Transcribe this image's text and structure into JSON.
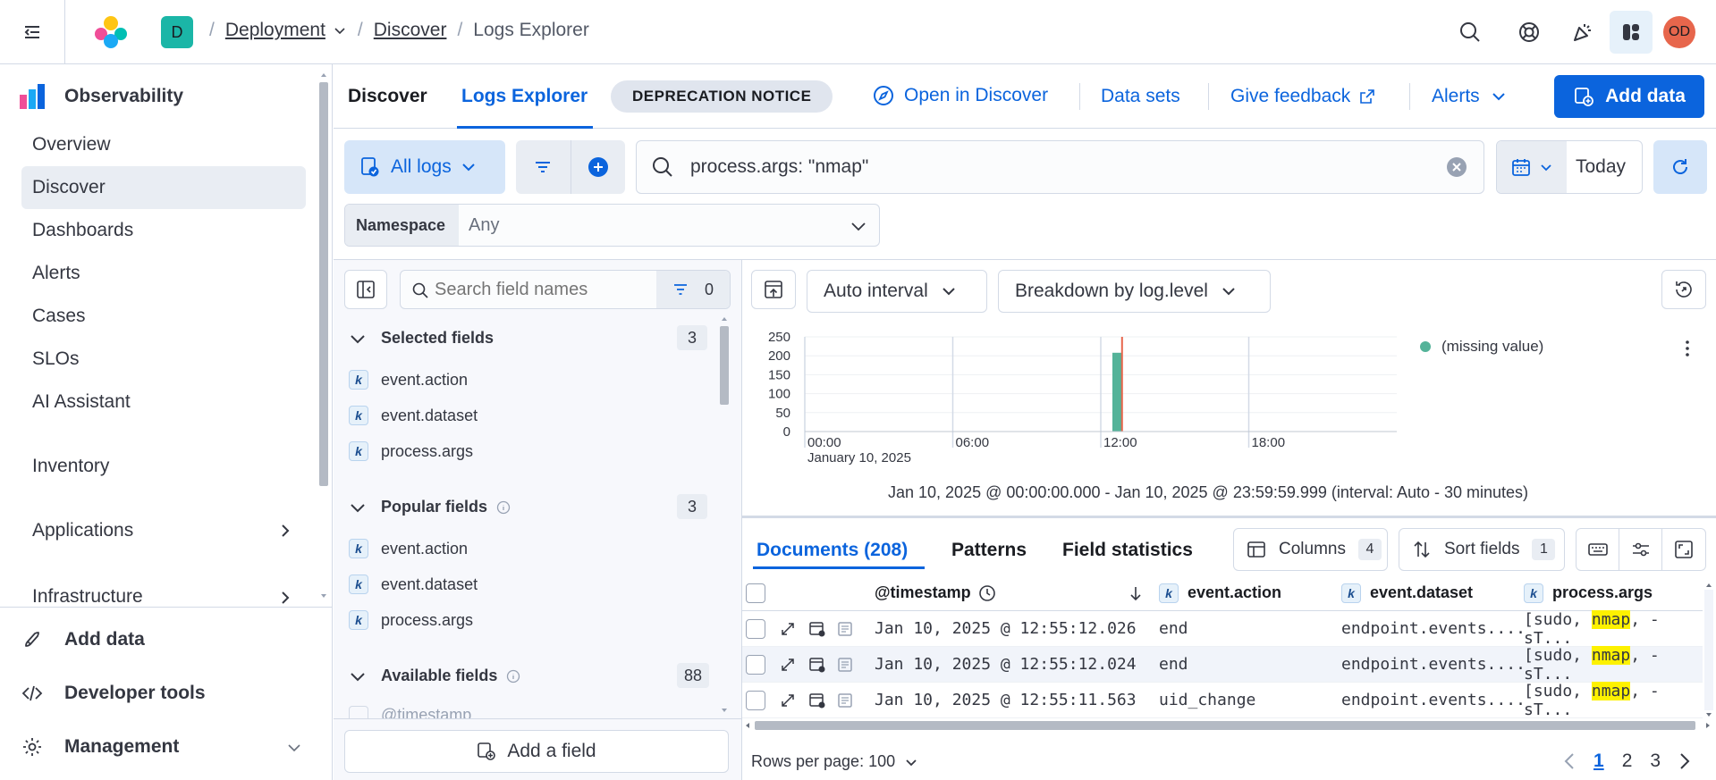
{
  "header": {
    "space_initial": "D",
    "breadcrumbs": [
      "Deployment",
      "Discover",
      "Logs Explorer"
    ],
    "avatar": "OD",
    "colors": {
      "space": "#1bb6a7",
      "avatar": "#e7664c"
    }
  },
  "sidebar": {
    "title": "Observability",
    "items": [
      "Overview",
      "Discover",
      "Dashboards",
      "Alerts",
      "Cases",
      "SLOs",
      "AI Assistant",
      "Inventory",
      "Applications",
      "Infrastructure"
    ],
    "footer": [
      "Add data",
      "Developer tools",
      "Management"
    ]
  },
  "tabs": {
    "discover": "Discover",
    "logs_explorer": "Logs Explorer",
    "notice": "DEPRECATION NOTICE",
    "open_in_discover": "Open in Discover",
    "data_sets": "Data sets",
    "give_feedback": "Give feedback",
    "alerts": "Alerts",
    "add_data": "Add data"
  },
  "query": {
    "data_view": "All logs",
    "text": "process.args: \"nmap\"",
    "date": "Today",
    "namespace_label": "Namespace",
    "namespace_value": "Any"
  },
  "fields_panel": {
    "search_placeholder": "Search field names",
    "filter_count": "0",
    "selected": {
      "title": "Selected fields",
      "count": "3",
      "items": [
        "event.action",
        "event.dataset",
        "process.args"
      ]
    },
    "popular": {
      "title": "Popular fields",
      "count": "3",
      "items": [
        "event.action",
        "event.dataset",
        "process.args"
      ]
    },
    "available": {
      "title": "Available fields",
      "count": "88",
      "first": "@timestamp"
    },
    "add_field": "Add a field"
  },
  "histogram": {
    "interval": "Auto interval",
    "breakdown": "Breakdown by log.level",
    "legend": "(missing value)",
    "date_label": "January 10, 2025",
    "range_text": "Jan 10, 2025 @ 00:00:00.000 - Jan 10, 2025 @ 23:59:59.999 (interval: Auto - 30 minutes)"
  },
  "chart_data": {
    "type": "bar",
    "x_ticks": [
      "00:00",
      "06:00",
      "12:00",
      "18:00"
    ],
    "y_ticks": [
      0,
      50,
      100,
      150,
      200,
      250
    ],
    "ylim": [
      0,
      250
    ],
    "x_range_hours": [
      0,
      24
    ],
    "bars": [
      {
        "x_hours": 12.0,
        "y": 208
      }
    ],
    "now_marker_hours": 12.5,
    "series": [
      {
        "name": "(missing value)",
        "color": "#54b399"
      }
    ],
    "legend_position": "top-right"
  },
  "docs": {
    "tabs": [
      "Documents (208)",
      "Patterns",
      "Field statistics"
    ],
    "columns_label": "Columns",
    "columns_count": "4",
    "sort_label": "Sort fields",
    "sort_count": "1",
    "headers": [
      "@timestamp",
      "event.action",
      "event.dataset",
      "process.args"
    ],
    "rows": [
      {
        "ts": "Jan 10, 2025 @ 12:55:12.026",
        "action": "end",
        "dataset": "endpoint.events....",
        "args_pre": "[sudo,",
        "args_hl": "nmap",
        "args_post": ", -sT..."
      },
      {
        "ts": "Jan 10, 2025 @ 12:55:12.024",
        "action": "end",
        "dataset": "endpoint.events....",
        "args_pre": "[sudo,",
        "args_hl": "nmap",
        "args_post": ", -sT..."
      },
      {
        "ts": "Jan 10, 2025 @ 12:55:11.563",
        "action": "uid_change",
        "dataset": "endpoint.events....",
        "args_pre": "[sudo,",
        "args_hl": "nmap",
        "args_post": ", -sT..."
      }
    ],
    "rows_per_page": "Rows per page: 100",
    "pages": [
      "1",
      "2",
      "3"
    ]
  }
}
